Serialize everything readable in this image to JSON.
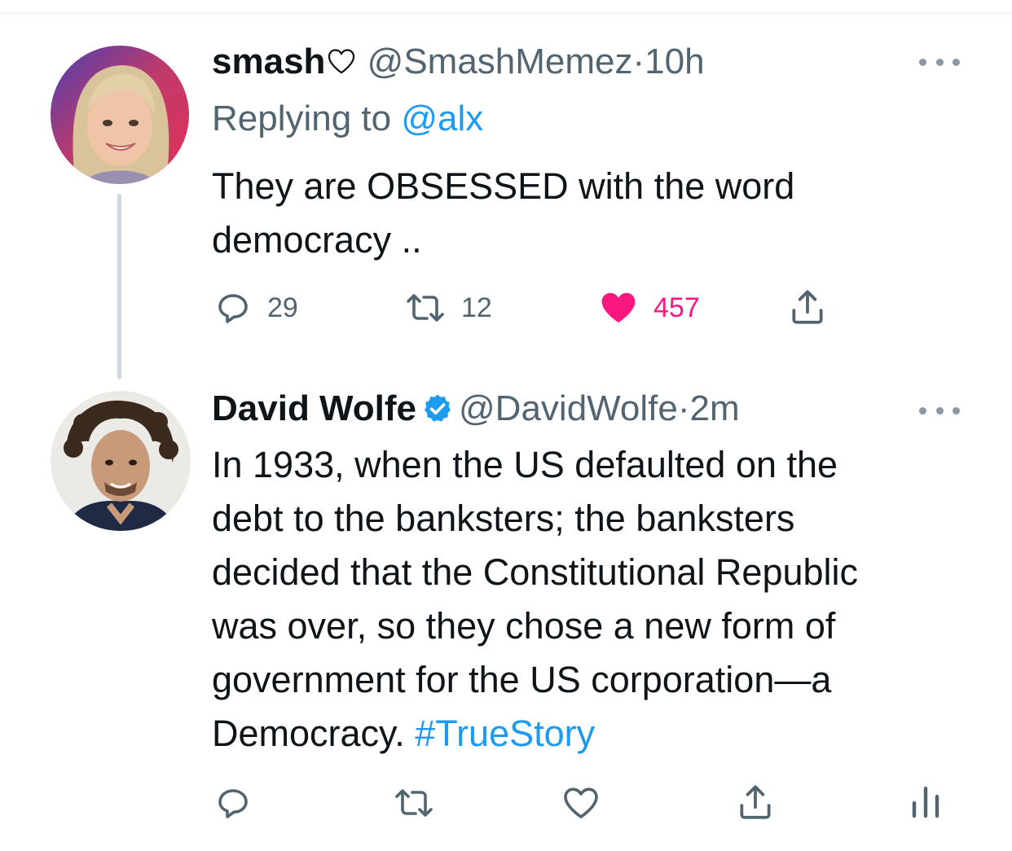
{
  "tweets": [
    {
      "display_name": "smash",
      "handle": "@SmashMemez",
      "separator": "·",
      "time": "10h",
      "replying_prefix": "Replying to",
      "replying_handle": "@alx",
      "text": "They are OBSESSED with the word\ndemocracy ..",
      "actions": {
        "reply_count": "29",
        "retweet_count": "12",
        "like_count": "457",
        "liked": true
      }
    },
    {
      "display_name": "David Wolfe",
      "handle": "@DavidWolfe",
      "separator": "·",
      "time": "2m",
      "verified": true,
      "text": "In 1933, when the US defaulted on the\ndebt to the banksters; the banksters\ndecided that the Constitutional Republic\nwas over, so they chose a new form of\ngovernment for the US corporation—a\nDemocracy. ",
      "hashtag": "#TrueStory",
      "actions": {
        "reply_count": "",
        "retweet_count": "",
        "like_count": ""
      }
    }
  ],
  "icons": {
    "reply": "reply-icon",
    "retweet": "retweet-icon",
    "like": "heart-icon",
    "share": "share-icon",
    "analytics": "analytics-icon",
    "more": "more-icon",
    "verified": "verified-badge-icon"
  },
  "colors": {
    "text": "#0f1419",
    "secondary": "#536471",
    "link": "#1d9bf0",
    "like": "#f91880",
    "thread_line": "#cfd9de"
  }
}
